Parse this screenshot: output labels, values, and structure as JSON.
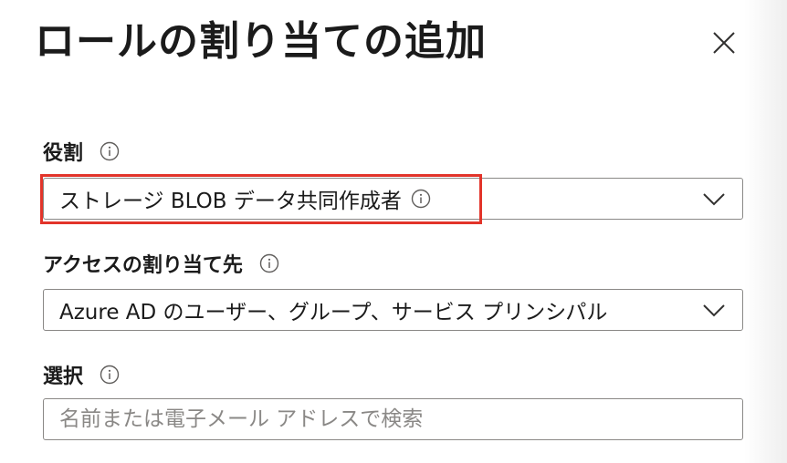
{
  "dialog": {
    "title": "ロールの割り当ての追加",
    "close_icon": "close-icon"
  },
  "role": {
    "label": "役割",
    "info_icon": "info-icon",
    "value": "ストレージ BLOB データ共同作成者",
    "value_info_icon": "info-icon",
    "chevron_icon": "chevron-down-icon",
    "highlight_color": "#e2342a"
  },
  "assign_access": {
    "label": "アクセスの割り当て先",
    "info_icon": "info-icon",
    "value": "Azure AD のユーザー、グループ、サービス プリンシパル",
    "chevron_icon": "chevron-down-icon"
  },
  "select": {
    "label": "選択",
    "info_icon": "info-icon",
    "placeholder": "名前または電子メール アドレスで検索",
    "value": ""
  }
}
